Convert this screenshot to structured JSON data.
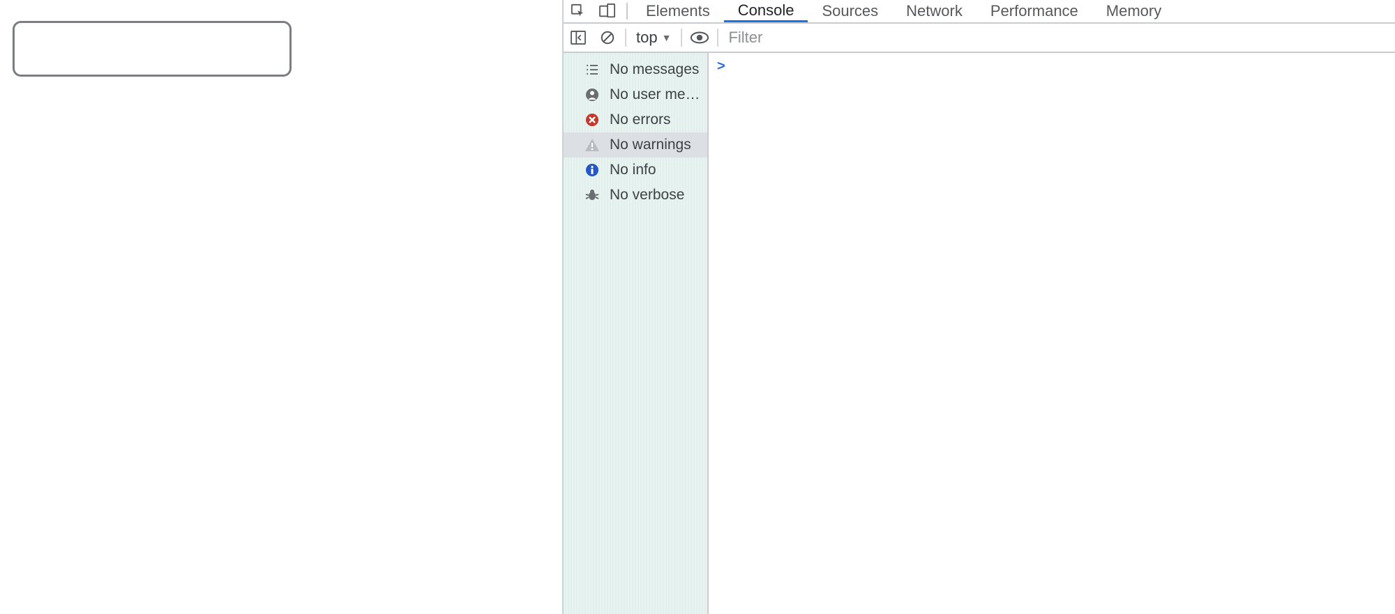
{
  "tabs": {
    "items": [
      {
        "label": "Elements"
      },
      {
        "label": "Console"
      },
      {
        "label": "Sources"
      },
      {
        "label": "Network"
      },
      {
        "label": "Performance"
      },
      {
        "label": "Memory"
      }
    ],
    "active_index": 1
  },
  "toolbar": {
    "context": "top",
    "filter_placeholder": "Filter"
  },
  "sidebar": {
    "items": [
      {
        "label": "No messages"
      },
      {
        "label": "No user messa..."
      },
      {
        "label": "No errors"
      },
      {
        "label": "No warnings"
      },
      {
        "label": "No info"
      },
      {
        "label": "No verbose"
      }
    ],
    "selected_index": 3
  },
  "console": {
    "prompt": ">"
  }
}
